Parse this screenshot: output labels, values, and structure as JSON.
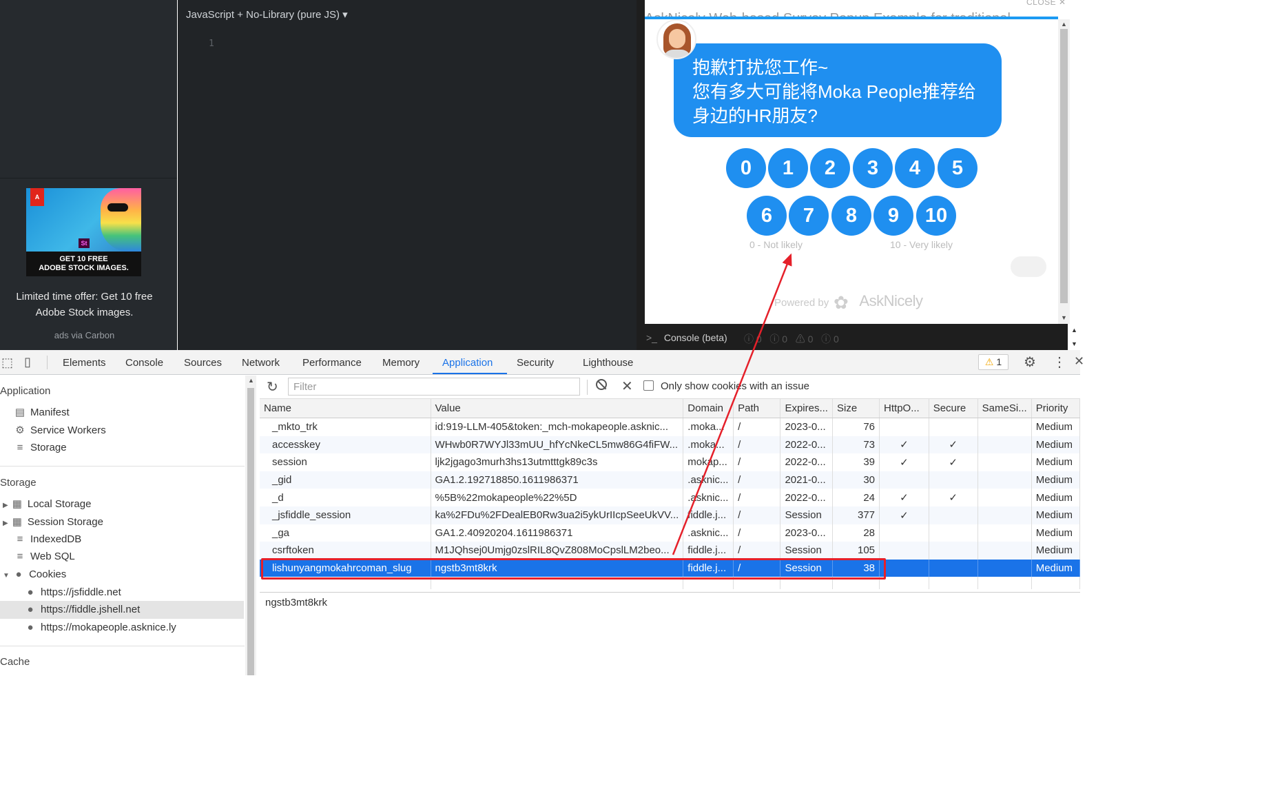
{
  "editor": {
    "language_select": "JavaScript + No-Library (pure JS) ▾",
    "line_number": "1"
  },
  "ad": {
    "banner_line1": "GET 10 FREE",
    "banner_line2": "ADOBE STOCK IMAGES.",
    "adobe_logo": "A",
    "st_badge": "St",
    "text_line1": "Limited time offer: Get 10 free",
    "text_line2": "Adobe Stock images.",
    "via": "ads via Carbon"
  },
  "result": {
    "close_label": "CLOSE",
    "close_icon": "✕",
    "behind_title": "AskNicely Web-based Survey Popup Example for traditional",
    "question_line1": "抱歉打扰您工作~",
    "question_line2": "您有多大可能将Moka People推荐给",
    "question_line3": "身边的HR朋友?",
    "scores": [
      "0",
      "1",
      "2",
      "3",
      "4",
      "5",
      "6",
      "7",
      "8",
      "9",
      "10"
    ],
    "low_caption": "0 - Not likely",
    "high_caption": "10 - Very likely",
    "powered_by": "Powered by",
    "brand": "AskNicely",
    "accent": "#1f8ff0"
  },
  "console": {
    "label": "Console (beta)",
    "counts": [
      "0",
      "0",
      "0",
      "0"
    ]
  },
  "devtools": {
    "tabs": [
      "Elements",
      "Console",
      "Sources",
      "Network",
      "Performance",
      "Memory",
      "Application",
      "Security",
      "Lighthouse"
    ],
    "active_tab": "Application",
    "warning_count": "1"
  },
  "sidebar": {
    "application_header": "Application",
    "app_items": [
      "Manifest",
      "Service Workers",
      "Storage"
    ],
    "storage_header": "Storage",
    "storage_items": [
      "Local Storage",
      "Session Storage",
      "IndexedDB",
      "Web SQL",
      "Cookies"
    ],
    "cookie_origins": [
      "https://jsfiddle.net",
      "https://fiddle.jshell.net",
      "https://mokapeople.asknice.ly"
    ],
    "selected_origin": "https://fiddle.jshell.net",
    "cache_header": "Cache"
  },
  "toolbar": {
    "filter_placeholder": "Filter",
    "only_issues_label": "Only show cookies with an issue"
  },
  "cookies": {
    "columns": [
      "Name",
      "Value",
      "Domain",
      "Path",
      "Expires...",
      "Size",
      "HttpO...",
      "Secure",
      "SameSi...",
      "Priority"
    ],
    "rows": [
      [
        "_mkto_trk",
        "id:919-LLM-405&token:_mch-mokapeople.asknic...",
        ".moka...",
        "/",
        "2023-0...",
        "76",
        "",
        "",
        "",
        "Medium"
      ],
      [
        "accesskey",
        "WHwb0R7WYJl33mUU_hfYcNkeCL5mw86G4fiFW...",
        ".moka...",
        "/",
        "2022-0...",
        "73",
        "✓",
        "✓",
        "",
        "Medium"
      ],
      [
        "session",
        "ljk2jgago3murh3hs13utmtttgk89c3s",
        "mokap...",
        "/",
        "2022-0...",
        "39",
        "✓",
        "✓",
        "",
        "Medium"
      ],
      [
        "_gid",
        "GA1.2.192718850.1611986371",
        ".asknic...",
        "/",
        "2021-0...",
        "30",
        "",
        "",
        "",
        "Medium"
      ],
      [
        "_d",
        "%5B%22mokapeople%22%5D",
        ".asknic...",
        "/",
        "2022-0...",
        "24",
        "✓",
        "✓",
        "",
        "Medium"
      ],
      [
        "_jsfiddle_session",
        "ka%2FDu%2FDealEB0Rw3ua2i5ykUrIIcpSeeUkVV...",
        "fiddle.j...",
        "/",
        "Session",
        "377",
        "✓",
        "",
        "",
        "Medium"
      ],
      [
        "_ga",
        "GA1.2.40920204.1611986371",
        ".asknic...",
        "/",
        "2023-0...",
        "28",
        "",
        "",
        "",
        "Medium"
      ],
      [
        "csrftoken",
        "M1JQhsej0Umjg0zslRIL8QvZ808MoCpslLM2beo...",
        "fiddle.j...",
        "/",
        "Session",
        "105",
        "",
        "",
        "",
        "Medium"
      ],
      [
        "lishunyangmokahrcoman_slug",
        "ngstb3mt8krk",
        "fiddle.j...",
        "/",
        "Session",
        "38",
        "",
        "",
        "",
        "Medium"
      ]
    ],
    "selected_row": 8,
    "preview_value": "ngstb3mt8krk"
  },
  "annotation": {
    "highlight_color": "#e5202a"
  }
}
